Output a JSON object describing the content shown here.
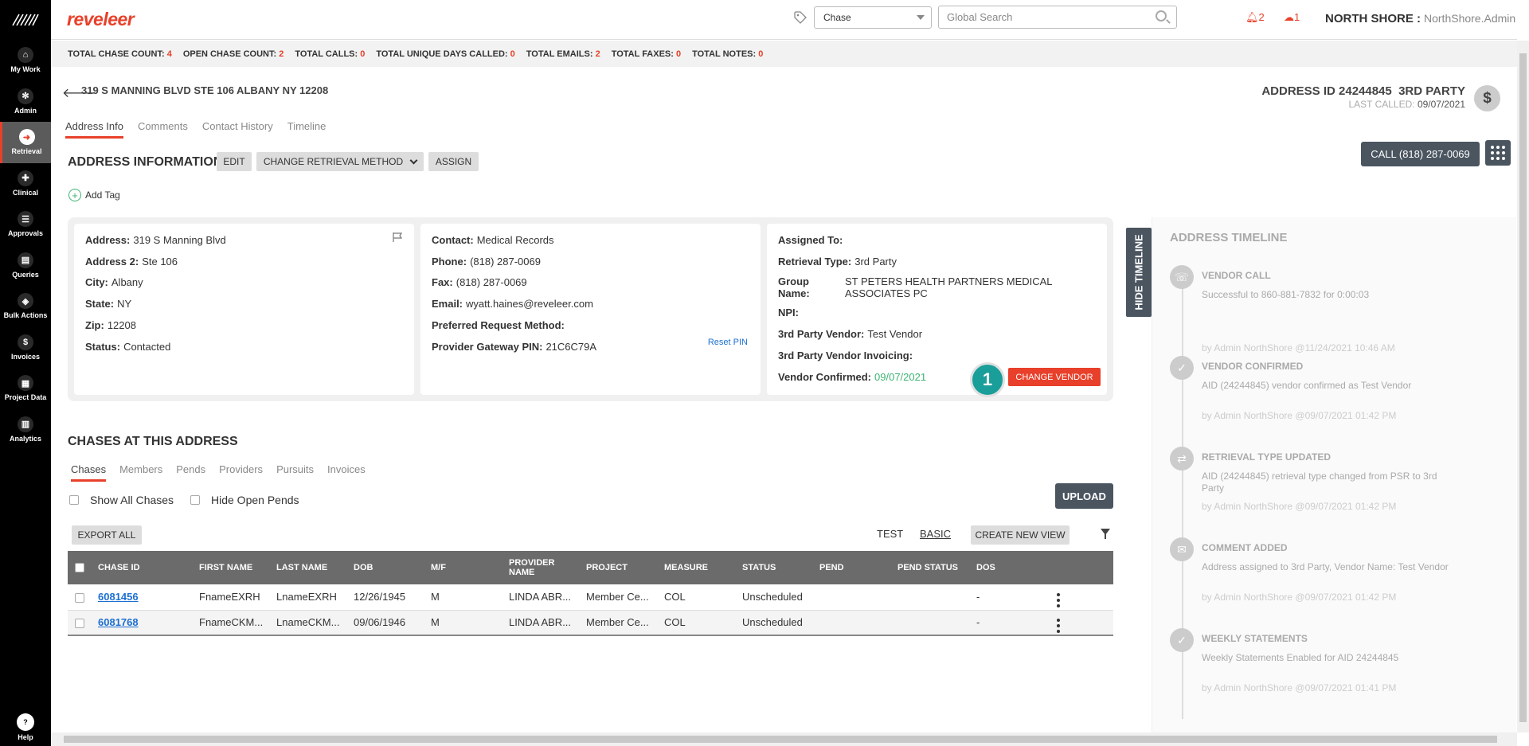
{
  "nav": {
    "items": [
      {
        "label": "My Work",
        "glyph": "⌂"
      },
      {
        "label": "Admin",
        "glyph": "✻"
      },
      {
        "label": "Retrieval",
        "glyph": "➜"
      },
      {
        "label": "Clinical",
        "glyph": "✚"
      },
      {
        "label": "Approvals",
        "glyph": "☰"
      },
      {
        "label": "Queries",
        "glyph": "▤"
      },
      {
        "label": "Bulk Actions",
        "glyph": "◈"
      },
      {
        "label": "Invoices",
        "glyph": "$"
      },
      {
        "label": "Project Data",
        "glyph": "▦"
      },
      {
        "label": "Analytics",
        "glyph": "▥"
      }
    ],
    "help_label": "Help",
    "active": "Retrieval"
  },
  "topbar": {
    "brand": "reveleer",
    "search_scope": "Chase",
    "search_placeholder": "Global Search",
    "alerts_count": "2",
    "cloud_count": "1",
    "org": "NORTH SHORE :",
    "user": "NorthShore.Admin"
  },
  "stats": [
    {
      "label": "TOTAL CHASE COUNT:",
      "value": "4"
    },
    {
      "label": "OPEN CHASE COUNT:",
      "value": "2"
    },
    {
      "label": "TOTAL CALLS:",
      "value": "0"
    },
    {
      "label": "TOTAL UNIQUE DAYS CALLED:",
      "value": "0"
    },
    {
      "label": "TOTAL EMAILS:",
      "value": "2"
    },
    {
      "label": "TOTAL FAXES:",
      "value": "0"
    },
    {
      "label": "TOTAL NOTES:",
      "value": "0"
    }
  ],
  "header": {
    "address": "319 S MANNING BLVD STE 106 ALBANY NY 12208",
    "address_id": "ADDRESS ID 24244845",
    "party": "3RD PARTY",
    "last_called_label": "LAST CALLED:",
    "last_called": "09/07/2021"
  },
  "tabs": [
    "Address Info",
    "Comments",
    "Contact History",
    "Timeline"
  ],
  "address_info": {
    "title": "ADDRESS INFORMATION",
    "edit": "EDIT",
    "change_method": "CHANGE RETRIEVAL METHOD",
    "assign": "ASSIGN",
    "call_button": "CALL (818) 287-0069",
    "add_tag": "Add Tag"
  },
  "card1": {
    "address_label": "Address:",
    "address": "319 S Manning Blvd",
    "address2_label": "Address 2:",
    "address2": "Ste 106",
    "city_label": "City:",
    "city": "Albany",
    "state_label": "State:",
    "state": "NY",
    "zip_label": "Zip:",
    "zip": "12208",
    "status_label": "Status:",
    "status": "Contacted"
  },
  "card2": {
    "contact_label": "Contact:",
    "contact": "Medical Records",
    "phone_label": "Phone:",
    "phone": "(818) 287-0069",
    "fax_label": "Fax:",
    "fax": "(818) 287-0069",
    "email_label": "Email:",
    "email": "wyatt.haines@reveleer.com",
    "pref_label": "Preferred Request Method:",
    "pin_label": "Provider Gateway PIN:",
    "pin": "21C6C79A",
    "reset_pin": "Reset PIN"
  },
  "card3": {
    "assigned_label": "Assigned To:",
    "retrieval_label": "Retrieval Type:",
    "retrieval": "3rd Party",
    "group_label": "Group Name:",
    "group": "ST PETERS HEALTH PARTNERS MEDICAL ASSOCIATES PC",
    "npi_label": "NPI:",
    "vendor_label": "3rd Party Vendor:",
    "vendor": "Test Vendor",
    "invoicing_label": "3rd Party Vendor Invoicing:",
    "confirmed_label": "Vendor Confirmed:",
    "confirmed": "09/07/2021",
    "step": "1",
    "change_vendor": "CHANGE VENDOR"
  },
  "chases": {
    "title": "CHASES AT THIS ADDRESS",
    "tabs": [
      "Chases",
      "Members",
      "Pends",
      "Providers",
      "Pursuits",
      "Invoices"
    ],
    "show_all": "Show All Chases",
    "hide_open": "Hide Open Pends",
    "upload": "UPLOAD",
    "export": "EXPORT ALL",
    "view_test": "TEST",
    "view_basic": "BASIC",
    "create_view": "CREATE NEW VIEW",
    "columns": [
      "CHASE ID",
      "FIRST NAME",
      "LAST NAME",
      "DOB",
      "M/F",
      "PROVIDER NAME",
      "PROJECT",
      "MEASURE",
      "STATUS",
      "PEND",
      "PEND STATUS",
      "DOS"
    ],
    "rows": [
      [
        "6081456",
        "FnameEXRH",
        "LnameEXRH",
        "12/26/1945",
        "M",
        "LINDA ABR...",
        "Member Ce...",
        "COL",
        "Unscheduled",
        "",
        "",
        "-"
      ],
      [
        "6081768",
        "FnameCKM...",
        "LnameCKM...",
        "09/06/1946",
        "M",
        "LINDA ABR...",
        "Member Ce...",
        "COL",
        "Unscheduled",
        "",
        "",
        "-"
      ]
    ]
  },
  "timeline": {
    "toggle": "HIDE TIMELINE",
    "title": "ADDRESS TIMELINE",
    "items": [
      {
        "glyph": "☏",
        "head": "VENDOR CALL",
        "desc": "Successful to 860-881-7832 for 0:00:03",
        "by": "by Admin NorthShore @11/24/2021 10:46 AM"
      },
      {
        "glyph": "✓",
        "head": "VENDOR CONFIRMED",
        "desc": "AID (24244845) vendor confirmed as Test Vendor",
        "by": "by Admin NorthShore @09/07/2021 01:42 PM"
      },
      {
        "glyph": "⇄",
        "head": "RETRIEVAL TYPE UPDATED",
        "desc": "AID (24244845) retrieval type changed from PSR to 3rd Party",
        "by": "by Admin NorthShore @09/07/2021 01:42 PM"
      },
      {
        "glyph": "✉",
        "head": "COMMENT ADDED",
        "desc": "Address assigned to 3rd Party, Vendor Name: Test Vendor",
        "by": "by Admin NorthShore @09/07/2021 01:42 PM"
      },
      {
        "glyph": "✓",
        "head": "WEEKLY STATEMENTS",
        "desc": "Weekly Statements Enabled for AID 24244845",
        "by": "by Admin NorthShore @09/07/2021 01:41 PM"
      }
    ]
  }
}
